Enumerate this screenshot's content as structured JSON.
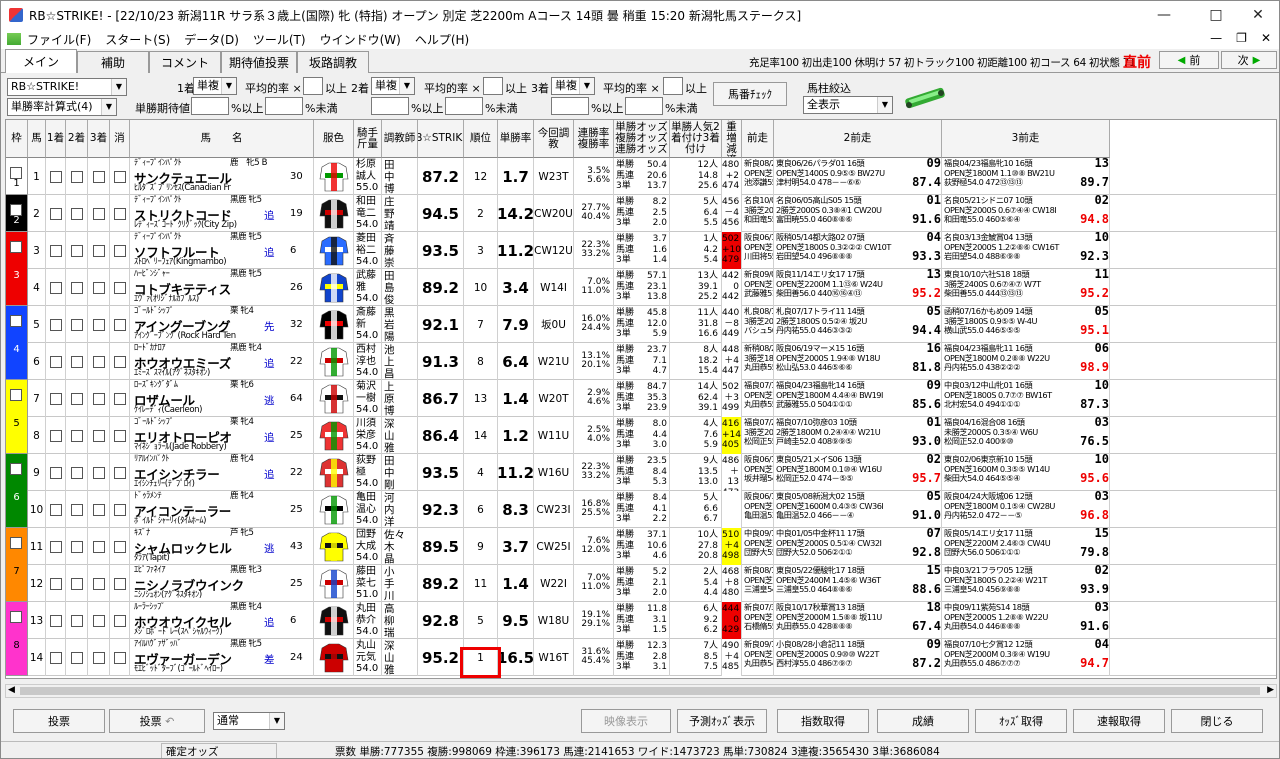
{
  "window": {
    "title": "RB☆STRIKE! - [22/10/23 新潟11R サラ系３歳上(国際) 牝 (特指) オープン 別定 芝2200m Aコース 14頭 曇 稍重 15:20 新潟牝馬ステークス]"
  },
  "menu": {
    "items": [
      "ファイル(F)",
      "スタート(S)",
      "データ(D)",
      "ツール(T)",
      "ウインドウ(W)",
      "ヘルプ(H)"
    ]
  },
  "tabs": [
    "メイン",
    "補助",
    "コメント",
    "期待値投票",
    "坂路調教"
  ],
  "stats": "充足率100 初出走100 休明け 57 初トラック100 初距離100 初コース 64 初状態 71",
  "status_now": "直前",
  "nav": {
    "prev": "前",
    "next": "次"
  },
  "filters": {
    "app_select": "RB☆STRIKE!",
    "calc_select": "単勝率計算式(4)",
    "rank1": "1着",
    "rank2": "2着",
    "rank3": "3着",
    "bet1": "単複",
    "bet2": "単複",
    "bet3": "単複",
    "avg_rate": "平均的率 ×",
    "above": "以上",
    "exp_label": "単勝期待値",
    "pct_above": "%以上",
    "pct_below": "%未満",
    "umaban_check": "馬番ﾁｪｯｸ",
    "filter_label": "馬柱絞込",
    "filter_value": "全表示"
  },
  "columns": [
    "枠",
    "馬",
    "1着",
    "2着",
    "3着",
    "消",
    "馬　　名",
    "服色",
    "騎手斤量",
    "調教師",
    "RB☆STRIKE!",
    "順位",
    "単勝率",
    "今回調教",
    "連勝率複勝率",
    "単勝オッズ複勝オッズ連勝オッズ",
    "単勝人気2着付け3着付け",
    "馬体重増減適正",
    "前走",
    "2前走",
    "3前走"
  ],
  "horses": [
    {
      "waku": "1",
      "num": "1",
      "sire": "ﾃﾞｨｰﾌﾟｲﾝﾊﾟｸﾄ",
      "sex": "鹿　牝5 B",
      "name": "サンクテュエール",
      "dam": "ﾋﾙﾀﾞｽﾞﾌﾟﾘﾝｾｽ(Canadian Fr",
      "mark": "",
      "wins": "30",
      "jockey": "杉原誠人55.0",
      "trainer": "田中博康",
      "score": "87.2",
      "rank": "12",
      "rate": "1.7",
      "train": "W23T",
      "ren": "3.5%",
      "fuku": "5.6%",
      "o1": "50.4",
      "o2": "20.6",
      "o3": "13.7",
      "p1": "12人",
      "p2": "14.8",
      "p3": "25.6",
      "wt": "480",
      "wd": "+2",
      "wa": "474",
      "r1a": "新良08/28朱鷺S13 18頭",
      "r1b": "15",
      "r1c": "OPEN芝1400M 0.7④⑥6 BW27U",
      "r1d": "池添謙55.0 478－－⑬⑬",
      "r1e": "86.5",
      "r2a": "東良06/26パラダ01 16頭",
      "r2b": "09",
      "r2c": "OPEN芝1400S 0.9⑤⑤ BW27U",
      "r2d": "津村明54.0 478－－⑥⑥",
      "r2e": "87.4",
      "r3a": "福良04/23福島牝10 16頭",
      "r3b": "13",
      "r3c": "OPEN芝1800M 1.1⑩⑧ BW21U",
      "r3d": "荻野極54.0 472⑬⑬⑬",
      "r3e": "89.7"
    },
    {
      "waku": "2",
      "num": "2",
      "sire": "ﾃﾞｨｰﾌﾟｲﾝﾊﾟｸﾄ",
      "sex": "黒鹿 牝5",
      "name": "ストリクトコード",
      "dam": "ﾚﾃﾞｨｰｽﾞｺｰﾄﾞｸﾘｸﾞｯｸ(City Zip)",
      "mark": "追",
      "wins": "19",
      "jockey": "和田竜二54.0",
      "trainer": "庄野靖志",
      "score": "94.5",
      "rank": "2",
      "rate": "14.2",
      "train": "CW20U",
      "ren": "27.7%",
      "fuku": "40.4%",
      "o1": "8.2",
      "o2": "2.5",
      "o3": "2.0",
      "p1": "5人",
      "p2": "6.4",
      "p3": "5.5",
      "wt": "456",
      "wd": "－4",
      "wa": "456",
      "r1a": "名良10/01関ケ原09 17頭",
      "r1b": "03",
      "r1c": "3勝芝2000S 0.3⑧④1 CW25I",
      "r1d": "和田竜55.0 460⑨⑨⑨",
      "r1e": "94.6",
      "r2a": "名良06/05高山S05 15頭",
      "r2b": "01",
      "r2c": "2勝芝2000S 0.3⑧④1 CW20U",
      "r2d": "富田暁55.0 460⑧⑧⑥",
      "r2e": "91.6",
      "r3a": "名良05/21シドニ07 10頭",
      "r3b": "02",
      "r3c": "OPEN芝2000S 0.6⑦④④ CW18I",
      "r3d": "和田竜55.0 460⑤⑥④",
      "r3e": "94.8"
    },
    {
      "waku": "3",
      "num": "3",
      "sire": "ﾃﾞｨｰﾌﾟｲﾝﾊﾟｸﾄ",
      "sex": "黒鹿 牝5",
      "name": "ソフトフルート",
      "dam": "ｽﾄﾛﾍﾞﾘｰﾌｪｱ(Kingmambo)",
      "mark": "追",
      "wins": "6",
      "jockey": "菱田裕二54.0",
      "trainer": "斉藤崇史",
      "score": "93.5",
      "rank": "3",
      "rate": "11.2",
      "train": "CW12U",
      "ren": "22.3%",
      "fuku": "33.2%",
      "o1": "3.7",
      "o2": "1.6",
      "o3": "1.4",
      "p1": "1人",
      "p2": "4.2",
      "p3": "5.4",
      "wt": "502",
      "wd": "+10",
      "wa": "479",
      "r1a": "阪良06/19マーメ03 16頭",
      "r1b": "03",
      "r1c": "OPEN芝2000S 0.3④④1 CW3I",
      "r1d": "川田将55.0 492⑭⑭⑮",
      "r1e": "95.7",
      "r2a": "阪稍05/14都大路02 07頭",
      "r2b": "04",
      "r2c": "OPEN芝1800S 0.3②②② CW10T",
      "r2d": "岩田望54.0 496⑧⑧⑧",
      "r2e": "93.3",
      "r3a": "名良03/13金鯱賞04 13頭",
      "r3b": "10",
      "r3c": "OPEN芝2000S 1.2②⑧⑥ CW16T",
      "r3d": "岩田望54.0 488⑥⑨⑧",
      "r3e": "92.3"
    },
    {
      "waku": "3",
      "num": "4",
      "sire": "ﾊｰﾋﾞﾝｼﾞｬｰ",
      "sex": "黒鹿 牝5",
      "name": "コトブキテティス",
      "dam": "ｴｳﾞｧ(ｵﾘｼﾞﾅﾙｶﾌﾞﾙｽ)",
      "mark": "",
      "wins": "26",
      "jockey": "武藤雅54.0",
      "trainer": "田島俊明",
      "score": "89.2",
      "rank": "10",
      "rate": "3.4",
      "train": "W14I",
      "ren": "7.0%",
      "fuku": "11.0%",
      "o1": "57.1",
      "o2": "23.1",
      "o3": "13.8",
      "p1": "13人",
      "p2": "39.1",
      "p3": "25.2",
      "wt": "442",
      "wd": "0",
      "wa": "442",
      "r1a": "新良09/04新潟記14 18頭",
      "r1b": "17",
      "r1c": "OPEN芝2000S 1.5②④③ 坂I",
      "r1d": "武藤雅51.0 444－－⑧⑨",
      "r1e": "84.5",
      "r2a": "阪良11/14エリ女17 17頭",
      "r2b": "13",
      "r2c": "OPEN芝2200M 1.1⑬⑥ W24U",
      "r2d": "柴田善56.0 440⑯⑯④⑬",
      "r2e": "95.2",
      "r3a": "東良10/10六社S18 18頭",
      "r3b": "11",
      "r3c": "3勝芝2400S 0.6⑦④⑦ W7T",
      "r3d": "柴田善55.0 444⑬⑬⑬",
      "r3e": "95.2"
    },
    {
      "waku": "4",
      "num": "5",
      "sire": "ｺﾞｰﾙﾄﾞｼｯﾌﾟ",
      "sex": "栗 牝4",
      "name": "アイングーブング",
      "dam": "ｱｲﾝｸﾞｰﾌﾞﾝｸﾞ(Rock Hard Ten",
      "mark": "先",
      "wins": "32",
      "jockey": "斎藤新54.0",
      "trainer": "黒岩陽一",
      "score": "92.1",
      "rank": "7",
      "rate": "7.9",
      "train": "坂0U",
      "ren": "16.0%",
      "fuku": "24.4%",
      "o1": "45.8",
      "o2": "12.0",
      "o3": "5.9",
      "p1": "11人",
      "p2": "31.8",
      "p3": "16.6",
      "wt": "440",
      "wd": "－8",
      "wa": "449",
      "r1a": "札良08/14WA405 14頭",
      "r1b": "01",
      "r1c": "3勝芝2000S 0.1⑤⑤② 坂5U",
      "r1d": "バシュ56.0 452②②②",
      "r1e": "93.8",
      "r2a": "札良07/17トライ11 14頭",
      "r2b": "05",
      "r2c": "2勝芝1800S 0.5②④ 坂2U",
      "r2d": "丹内祐55.0 446③③②",
      "r2e": "94.4",
      "r3a": "函稍07/16かもめ09 14頭",
      "r3b": "05",
      "r3c": "3勝芝1800S 0.9⑤⑤ W-4U",
      "r3d": "横山武55.0 446⑤⑤⑤",
      "r3e": "95.1"
    },
    {
      "waku": "4",
      "num": "6",
      "sire": "ﾛｰﾄﾞｶﾅﾛｱ",
      "sex": "黒鹿 牝4",
      "name": "ホウオウエミーズ",
      "dam": "ｴﾐｰｽﾞｽﾏｲﾙ(ｱｸﾞﾈｽﾀｷｵﾝ)",
      "mark": "追",
      "wins": "22",
      "jockey": "西村淳也54.0",
      "trainer": "池上昌和",
      "score": "91.3",
      "rank": "8",
      "rate": "6.4",
      "train": "W21U",
      "ren": "13.1%",
      "fuku": "20.1%",
      "o1": "23.7",
      "o2": "7.1",
      "o3": "4.7",
      "p1": "8人",
      "p2": "18.2",
      "p3": "15.4",
      "wt": "448",
      "wd": "＋4",
      "wa": "447",
      "r1a": "新稍08/27ＢＳＮ13 15頭",
      "r1b": "06",
      "r1c": "3勝芝1800S 0.1⑧⑥ W19U",
      "r1d": "丸田恭55.0 448⑦⑦⑦",
      "r1e": "90.2",
      "r2a": "阪良06/19マーメ15 16頭",
      "r2b": "16",
      "r2c": "OPEN芝2000S 1.9④⑧ W18U",
      "r2d": "松山弘53.0 446⑤⑥⑥",
      "r2e": "81.8",
      "r3a": "福良04/23福島牝11 16頭",
      "r3b": "06",
      "r3c": "OPEN芝1800M 0.2⑧⑧ W22U",
      "r3d": "丹内祐55.0 438②②②",
      "r3e": "98.9"
    },
    {
      "waku": "5",
      "num": "7",
      "sire": "ﾛｰｽﾞｷﾝｸﾞﾀﾞﾑ",
      "sex": "栗 牝6",
      "name": "ロザムール",
      "dam": "ｹｲﾚｰﾃﾞｨ(Caerleon)",
      "mark": "逃",
      "wins": "64",
      "jockey": "菊沢一樹54.0",
      "trainer": "上原博之",
      "score": "86.7",
      "rank": "13",
      "rate": "1.4",
      "train": "W20T",
      "ren": "2.9%",
      "fuku": "4.6%",
      "o1": "84.7",
      "o2": "35.3",
      "o3": "23.9",
      "p1": "14人",
      "p2": "62.4",
      "p3": "39.1",
      "wt": "502",
      "wd": "＋3",
      "wa": "499",
      "r1a": "福良07/10七夕賞01 12頭",
      "r1b": "12",
      "r1c": "OPEN芝2000M 1.6③③ BW22U",
      "r1d": "丸田恭55.0 502①①①",
      "r1e": "86.8",
      "r2a": "福良04/23福島牝14 16頭",
      "r2b": "09",
      "r2c": "OPEN芝1800M 4.4④④ BW19I",
      "r2d": "武藤雅55.0 504①①①",
      "r2e": "85.6",
      "r3a": "中良03/12中山牝01 16頭",
      "r3b": "10",
      "r3c": "OPEN芝1800S 0.7⑦⑦ BW16T",
      "r3d": "北村宏54.0 494①①①",
      "r3e": "87.3"
    },
    {
      "waku": "5",
      "num": "8",
      "sire": "ｺﾞｰﾙﾄﾞｼｯﾌﾟ",
      "sex": "栗 牝4",
      "name": "エリオトローピオ",
      "dam": "ﾏｲﾈｼﾞｮﾗｰﾙ(Jade Robbery)",
      "mark": "追",
      "wins": "25",
      "jockey": "川須栄彦54.0",
      "trainer": "深山雅史",
      "score": "86.4",
      "rank": "14",
      "rate": "1.2",
      "train": "W11U",
      "ren": "2.5%",
      "fuku": "4.0%",
      "o1": "8.0",
      "o2": "4.4",
      "o3": "3.0",
      "p1": "4人",
      "p2": "7.6",
      "p3": "5.9",
      "wt": "416",
      "wd": "+14",
      "wa": "405",
      "r1a": "福良07/24阿武03 16頭",
      "r1b": "01",
      "r1c": "3勝芝2000M 0.2⑤⑤ W20U",
      "r1d": "松岡正55.0 402⑤④⑨",
      "r1e": "93.8",
      "r2a": "福良07/10弥彦03 10頭",
      "r2b": "01",
      "r2c": "2勝芝1800M 0.2④④④ W21U",
      "r2d": "戸崎圭52.0 408⑨⑨⑤",
      "r2e": "93.0",
      "r3a": "福良04/16混合08 16頭",
      "r3b": "03",
      "r3c": "未勝芝2000S 0.3⑤④ W6U",
      "r3d": "松岡正52.0 400⑨⑩",
      "r3e": "76.5"
    },
    {
      "waku": "6",
      "num": "9",
      "sire": "ﾘｱﾙｲﾝﾊﾟｸﾄ",
      "sex": "鹿 牝4",
      "name": "エイシンチラー",
      "dam": "ｴｲｼﾝﾁｪﾘｰ(ﾃﾞﾌﾟﾛｲ)",
      "mark": "追",
      "wins": "22",
      "jockey": "荻野極54.0",
      "trainer": "田中剛",
      "score": "93.5",
      "rank": "4",
      "rate": "11.2",
      "train": "W16U",
      "ren": "22.3%",
      "fuku": "33.2%",
      "o1": "23.5",
      "o2": "8.4",
      "o3": "5.3",
      "p1": "9人",
      "p2": "13.5",
      "p3": "13.0",
      "wt": "486",
      "wd": "＋13",
      "wa": "473",
      "r1a": "阪良06/18米子S10 16頭",
      "r1b": "10",
      "r1c": "OPEN芝1800M 0.3⑧⑧ W20U",
      "r1d": "坂井瑠54.0 474⑤⑤",
      "r1e": "84.9",
      "r2a": "東良05/21メイS06 13頭",
      "r2b": "02",
      "r2c": "OPEN芝1800M 0.1⑩④ W16U",
      "r2d": "松岡正52.0 474－⑤⑤",
      "r2e": "95.7",
      "r3a": "東良02/06東京新10 15頭",
      "r3b": "10",
      "r3c": "OPEN芝1600M 0.3⑤⑤ W14U",
      "r3d": "柴田大54.0 464⑤⑤④",
      "r3e": "95.6"
    },
    {
      "waku": "6",
      "num": "10",
      "sire": "ﾄﾞｩﾗﾒﾝﾃ",
      "sex": "鹿 牝4",
      "name": "アイコンテーラー",
      "dam": "ﾎﾞｲﾙﾄﾞｼｬｰﾘｨ(ﾀｲﾑﾎｰﾑ)",
      "mark": "",
      "wins": "25",
      "jockey": "亀田温心54.0",
      "trainer": "河内洋",
      "score": "92.3",
      "rank": "6",
      "rate": "8.3",
      "train": "CW23I",
      "ren": "16.8%",
      "fuku": "25.5%",
      "o1": "8.4",
      "o2": "4.1",
      "o3": "2.2",
      "p1": "5人",
      "p2": "6.6",
      "p3": "6.7",
      "wt": "",
      "wd": "",
      "wa": "",
      "r1a": "阪良06/19マーメ05 16頭",
      "r1b": "07",
      "r1c": "OPEN芝2000S 1.3⑧⑤ CW21T",
      "r1d": "亀田温53.0 470⑤⑤⑥",
      "r1e": "85.7",
      "r2a": "東良05/08新潟大02 15頭",
      "r2b": "05",
      "r2c": "OPEN芝1600M 0.4③⑤ CW36I",
      "r2d": "亀田温52.0 466－－④",
      "r2e": "91.0",
      "r3a": "阪良04/24大阪城06 12頭",
      "r3b": "03",
      "r3c": "OPEN芝1800M 0.1⑤④ CW28U",
      "r3d": "丹内祐52.0 472－－⑤",
      "r3e": "96.8"
    },
    {
      "waku": "7",
      "num": "11",
      "sire": "ｷｽﾞﾅ",
      "sex": "芦 牝5",
      "name": "シャムロックヒル",
      "dam": "ﾀﾗｱ(Tapit)",
      "mark": "逃",
      "wins": "43",
      "jockey": "団野大成54.0",
      "trainer": "佐々木晶",
      "score": "89.5",
      "rank": "9",
      "rate": "3.7",
      "train": "CW25I",
      "ren": "7.6%",
      "fuku": "12.0%",
      "o1": "37.1",
      "o2": "10.6",
      "o3": "4.6",
      "p1": "10人",
      "p2": "27.8",
      "p3": "20.8",
      "wt": "510",
      "wd": "＋4",
      "wa": "498",
      "r1a": "中良09/12中山牝07 16頭",
      "r1b": "07",
      "r1c": "OPEN芝1800S 0.6①④ CW11I",
      "r1d": "団野大55.0 506①①①",
      "r1e": "89.7",
      "r2a": "中良01/05中金杯11 17頭",
      "r2b": "07",
      "r2c": "OPEN芝2000S 0.5①④ CW32I",
      "r2d": "団野大52.0 506②①①",
      "r2e": "92.8",
      "r3a": "阪良05/14エリ女17 11頭",
      "r3b": "15",
      "r3c": "OPEN芝2200M 2.4⑥③ CW4U",
      "r3d": "団野大56.0 506①①①",
      "r3e": "79.8"
    },
    {
      "waku": "7",
      "num": "12",
      "sire": "ｴﾋﾟﾌｧﾈｲｱ",
      "sex": "黒鹿 牝3",
      "name": "ニシノラブウインク",
      "dam": "ﾆｼﾉｼｭｵﾝ(ｱｸﾞﾈｽﾀｷｵﾝ)",
      "mark": "",
      "wins": "25",
      "jockey": "藤田菜七51.0",
      "trainer": "小手川準",
      "score": "89.2",
      "rank": "11",
      "rate": "1.4",
      "train": "W22I",
      "ren": "7.0%",
      "fuku": "11.0%",
      "o1": "5.2",
      "o2": "2.1",
      "o3": "2.0",
      "p1": "2人",
      "p2": "5.4",
      "p3": "4.4",
      "wt": "468",
      "wd": "＋8",
      "wa": "480",
      "r1a": "新良08/10紫苑S04 12頭",
      "r1b": "04",
      "r1c": "OPEN芝2000M 0.2②④ W20T",
      "r1d": "三浦皇54.0 460⑦⑦⑦",
      "r1e": "86.6",
      "r2a": "東良05/22優駿牝17 18頭",
      "r2b": "15",
      "r2c": "OPEN芝2400M 1.4⑤⑥ W36T",
      "r2d": "三浦皇55.0 464⑧⑧⑥",
      "r2e": "88.6",
      "r3a": "中良03/21フラワ05 12頭",
      "r3b": "02",
      "r3c": "OPEN芝1800S 0.2②④ W21T",
      "r3d": "三浦皇54.0 456⑨⑧⑧",
      "r3e": "93.9"
    },
    {
      "waku": "8",
      "num": "13",
      "sire": "ﾙｰﾗｰｼｯﾌﾟ",
      "sex": "黒鹿 牝4",
      "name": "ホウオウイクセル",
      "dam": "ﾒｼﾞﾛﾎﾞｰﾄﾞﾚｰ(ｽﾍﾟｼｬﾙｳｨｰｸ)",
      "mark": "追",
      "wins": "6",
      "jockey": "丸田恭介54.0",
      "trainer": "高柳瑞樹",
      "score": "92.8",
      "rank": "5",
      "rate": "9.5",
      "train": "W18U",
      "ren": "19.1%",
      "fuku": "29.1%",
      "o1": "11.8",
      "o2": "3.1",
      "o3": "1.5",
      "p1": "6人",
      "p2": "9.2",
      "p3": "6.2",
      "wt": "444",
      "wd": "0",
      "wa": "429",
      "r1a": "新良07/30関越S01 16頭",
      "r1b": "05",
      "r1c": "OPEN芝1800S 0.4①⑤ W21U",
      "r1d": "石橋脩55.0 444－⑤④",
      "r1e": "91.3",
      "r2a": "阪良10/17秋華賞13 18頭",
      "r2b": "18",
      "r2c": "OPEN芝2000M 1.5⑧⑧ 坂11U",
      "r2d": "丸田恭55.0 428⑧⑧⑧",
      "r2e": "67.4",
      "r3a": "中良09/11紫苑S14 18頭",
      "r3b": "03",
      "r3c": "OPEN芝2000S 1.2⑧⑧ W22U",
      "r3d": "丸田恭54.0 446⑧⑧⑧",
      "r3e": "91.6"
    },
    {
      "waku": "8",
      "num": "14",
      "sire": "ｱｲﾙﾊｳﾞｧｻﾞｯﾊﾞ",
      "sex": "黒鹿 牝5",
      "name": "エヴァーガーデン",
      "dam": "ﾓｴﾋﾞｯﾄﾞﾀｰﾌﾞ(ｺﾞｰﾙﾄﾞﾍｲﾛｰ)",
      "mark": "差",
      "wins": "24",
      "jockey": "丸山元気54.0",
      "trainer": "深山雅史",
      "score": "95.2",
      "rank": "1",
      "rate": "16.5",
      "train": "W16T",
      "ren": "31.6%",
      "fuku": "45.4%",
      "o1": "12.3",
      "o2": "2.8",
      "o3": "3.1",
      "p1": "7人",
      "p2": "8.5",
      "p3": "7.5",
      "wt": "490",
      "wd": "＋4",
      "wa": "485",
      "r1a": "新良09/17ケフェ06 10頭",
      "r1b": "02",
      "r1c": "OPEN芝2000S 0.2④④ W22T",
      "r1d": "丸田恭54.0 486⑧⑧②",
      "r1e": "97.1",
      "r2a": "小良08/28小倉記11 18頭",
      "r2b": "09",
      "r2c": "OPEN芝2000S 0.9⑩⑩ W22T",
      "r2d": "西村淳55.0 486⑦⑨⑦",
      "r2e": "87.2",
      "r3a": "福良07/10七夕賞12 12頭",
      "r3b": "04",
      "r3c": "OPEN芝2000M 0.3⑨④ W19U",
      "r3d": "丸田恭55.0 486⑦⑦⑦",
      "r3e": "94.7"
    }
  ],
  "bottom": {
    "vote": "投票",
    "vote_back": "投票",
    "mode": "通常",
    "video": "映像表示",
    "forecast": "予測ｵｯｽﾞ表示",
    "index": "指数取得",
    "result": "成績",
    "odds": "ｵｯｽﾞ取得",
    "rapid": "速報取得",
    "close": "閉じる"
  },
  "status": {
    "confirm": "確定オッズ",
    "votes": "票数 単勝:777355 複勝:998069 枠連:396173 馬連:2141653 ワイド:1473723 馬単:730824 3連複:3565430 3単:3686084"
  }
}
